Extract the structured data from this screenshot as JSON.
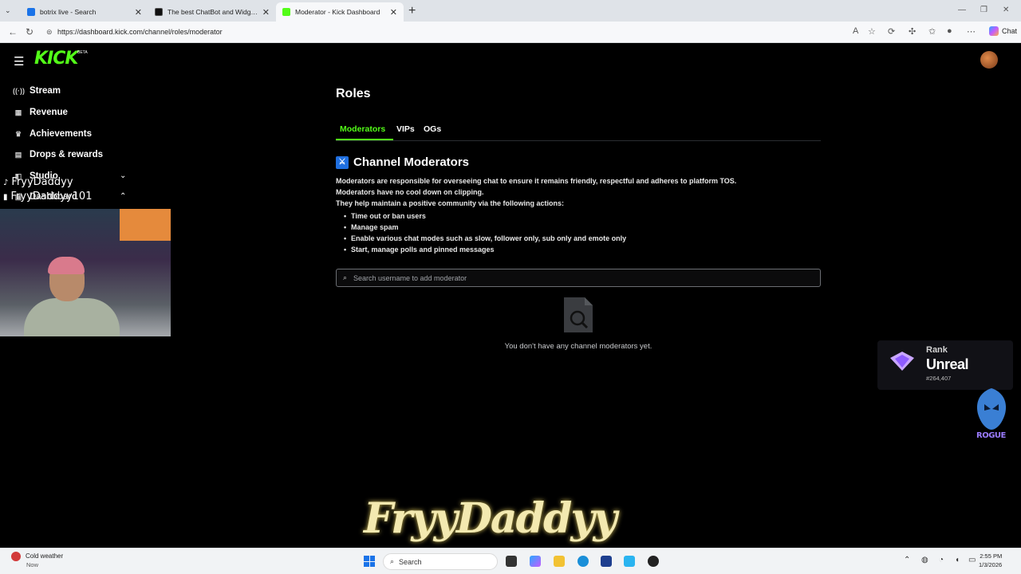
{
  "browser": {
    "tabs": [
      {
        "title": "botrix live - Search",
        "favicon_color": "#1a73e8"
      },
      {
        "title": "The best ChatBot and Widgets fo",
        "favicon_color": "#111111"
      },
      {
        "title": "Moderator - Kick Dashboard",
        "favicon_color": "#53fc18"
      }
    ],
    "new_tab": "+",
    "url": "https://dashboard.kick.com/channel/roles/moderator",
    "chat_button": "Chat"
  },
  "app": {
    "logo": "KICK",
    "beta": "BETA",
    "sidebar": {
      "items": [
        {
          "label": "Stream",
          "icon": "stream-icon",
          "glyph": "((·))"
        },
        {
          "label": "Revenue",
          "icon": "revenue-icon",
          "glyph": "▦"
        },
        {
          "label": "Achievements",
          "icon": "trophy-icon",
          "glyph": "🏆"
        },
        {
          "label": "Drops & rewards",
          "icon": "gift-icon",
          "glyph": "▤"
        },
        {
          "label": "Studio",
          "icon": "studio-icon",
          "glyph": "◧"
        },
        {
          "label": "Dashboard",
          "icon": "dashboard-icon",
          "glyph": "▣"
        }
      ]
    },
    "page_title": "Roles",
    "role_tabs": [
      "Moderators",
      "VIPs",
      "OGs"
    ],
    "section": {
      "title": "Channel Moderators",
      "description": [
        "Moderators are responsible for overseeing chat to ensure it remains friendly, respectful and adheres to platform TOS.",
        "Moderators have no cool down on clipping.",
        "They help maintain a positive community via the following actions:"
      ],
      "actions": [
        "Time out or ban users",
        "Manage spam",
        "Enable various chat modes such as slow, follower only, sub only and emote only",
        "Start, manage polls and pinned messages"
      ]
    },
    "search": {
      "placeholder": "Search username to add moderator",
      "value": ""
    },
    "empty_state": "You don't have any channel moderators yet."
  },
  "overlays": {
    "tiktok_name": "FryyDaddyy",
    "twitch_name": "FryyDaddyy101",
    "rank": {
      "label": "Rank",
      "value": "Unreal",
      "position": "#264,407"
    },
    "rogue": "ROGUE",
    "big_name": "FryyDaddyy"
  },
  "taskbar": {
    "weather": "Cold weather",
    "weather_sub": "Now",
    "search_label": "Search",
    "time": "2:55 PM",
    "date": "1/3/2026"
  }
}
